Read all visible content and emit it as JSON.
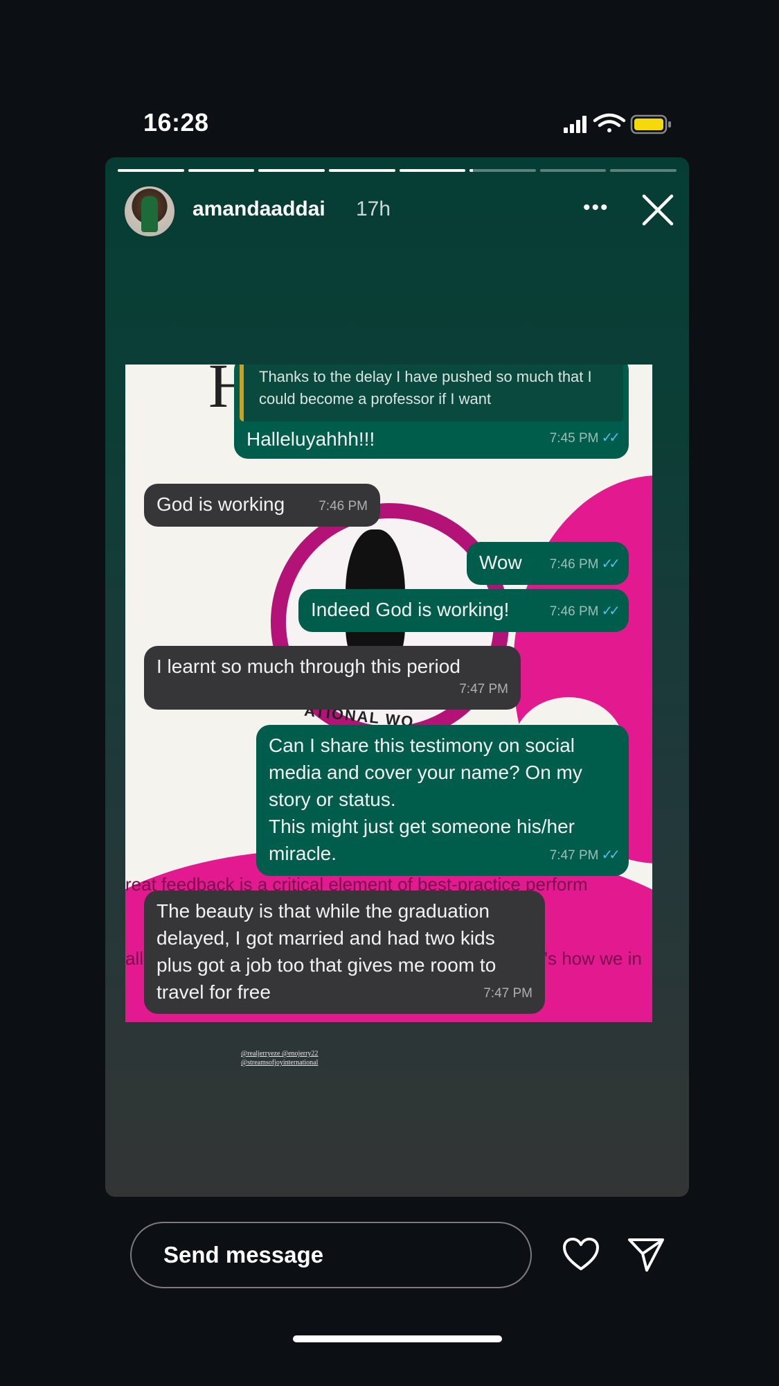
{
  "status_bar": {
    "time": "16:28",
    "battery_color": "#f5d90a"
  },
  "story": {
    "progress": [
      1,
      1,
      1,
      1,
      1,
      0.05,
      0,
      0
    ],
    "username": "amandaaddai",
    "age": "17h",
    "more_label": "•••",
    "close_icon": "close-icon"
  },
  "chat": {
    "quote_text": "Thanks to the delay I have pushed so much that I could become a professor if I want",
    "messages": [
      {
        "text": "Halleluyahhh!!!",
        "time": "7:45 PM",
        "ticks": "✓✓"
      },
      {
        "text": "God is working",
        "time": "7:46 PM"
      },
      {
        "text": "Wow",
        "time": "7:46 PM",
        "ticks": "✓✓"
      },
      {
        "text": "Indeed God is working!",
        "time": "7:46 PM",
        "ticks": "✓✓"
      },
      {
        "text": "I learnt so much through this period",
        "time": "7:47 PM"
      },
      {
        "text": "Can I share this testimony on social media and cover your name? On my story or status.\nThis might just get someone his/her miracle.",
        "time": "7:47 PM",
        "ticks": "✓✓"
      },
      {
        "text": "The beauty is that while the graduation delayed, I got married and had two kids plus got a job too that gives me room to travel for free",
        "time": "7:47 PM"
      }
    ],
    "background": {
      "letter": "H",
      "arc_text": "ATIONAL WO",
      "line1": "reat feedback is a critical element of best-practice perform",
      "line2_left": "all",
      "line2_right": "'s how we in"
    }
  },
  "credits": {
    "line1": "@realjerryeze @enojerry22",
    "line2": "@streamsofjoyinternational"
  },
  "bottom": {
    "placeholder": "Send message"
  },
  "colors": {
    "outgoing": "#005c4b",
    "incoming": "#363638",
    "pink": "#e2198f",
    "ticks": "#53bdeb"
  }
}
